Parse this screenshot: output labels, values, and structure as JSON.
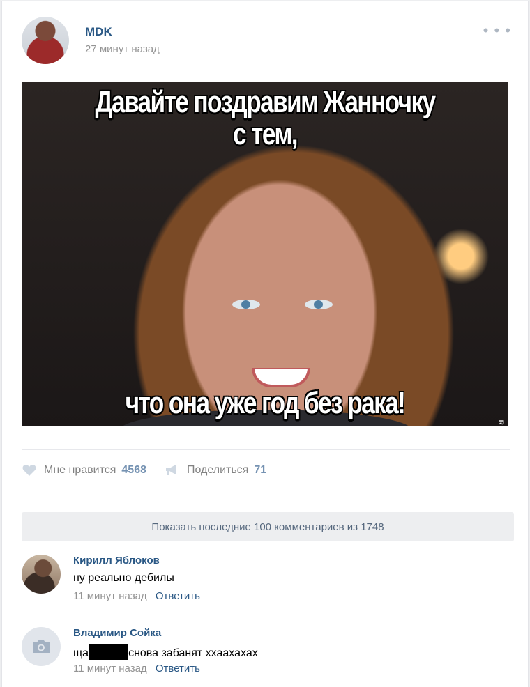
{
  "post": {
    "author": "MDK",
    "time": "27 минут назад",
    "menu_icon": "more-dots-icon",
    "meme": {
      "top_line_1": "Давайте поздравим Жанночку",
      "top_line_2": "с тем,",
      "bottom_line": "что она уже год без рака!",
      "watermark": "ROFLBOT"
    }
  },
  "actions": {
    "like": {
      "icon": "heart-icon",
      "label": "Мне нравится",
      "count": "4568"
    },
    "share": {
      "icon": "megaphone-icon",
      "label": "Поделиться",
      "count": "71"
    }
  },
  "comments_loader": "Показать последние 100 комментариев из 1748",
  "comments": [
    {
      "name": "Кирилл Яблоков",
      "text": "ну реально дебилы",
      "time": "11 минут назад",
      "reply": "Ответить"
    },
    {
      "name": "Владимир Сойка",
      "text_before": "ща",
      "text_after": "снова забанят ххаахахах",
      "time": "11 минут назад",
      "reply": "Ответить",
      "avatar_icon": "camera-icon"
    }
  ],
  "colors": {
    "link": "#2a5885",
    "muted": "#939393",
    "count": "#7592b2",
    "loader_bg": "#edeef0"
  }
}
